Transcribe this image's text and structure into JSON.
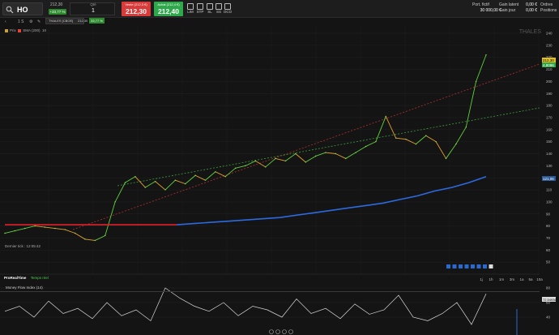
{
  "topbar": {
    "symbol": "HO",
    "last_price": "212,30",
    "change_pct": "+33,77 %",
    "qty_label": "Qté",
    "qty_value": "1",
    "sell_label": "Vente (212,3 €)",
    "sell_price": "212,30",
    "buy_label": "Achat (212,4 €)",
    "buy_price": "212,40",
    "order_types": [
      "LIM",
      "STP",
      "SL",
      "SS",
      "OCO"
    ],
    "portfolio_label": "Port. fictif",
    "portfolio_value": "30 000,00 €",
    "pnl_latent_label": "Gain latent",
    "pnl_latent_value": "0,00 €",
    "pnl_day_label": "Gain jour",
    "pnl_day_value": "0,00 €",
    "orders_label": "Ordres",
    "orders_value": "0",
    "positions_label": "Positions",
    "positions_value": "0"
  },
  "toolbar": {
    "interval": "1 S",
    "instrument_tag": "THALES [CBOE]",
    "instrument_price": "212,30",
    "instrument_pct": "33,77 %"
  },
  "legend": {
    "items": [
      {
        "label": "Prix",
        "color": "#c8a040"
      },
      {
        "label": "SMA (200)",
        "color": "#e0443a"
      },
      {
        "label": "10",
        "color": "#555555"
      }
    ]
  },
  "chart": {
    "watermark": "THALES",
    "last_price_tag": "212,30",
    "sma_tag": "4,8096",
    "sma200_tag": "121,06",
    "timestamp": "Dernier tick : 12:05:42",
    "pp_label": "ProRealTime",
    "pp_sub": "Temps réel",
    "timeframes": [
      "1j",
      "1h",
      "1m",
      "3m",
      "1a",
      "5a",
      "10a"
    ],
    "sub_indicator": "Money Flow Index (14)",
    "sub_value_tag": "72,54936"
  },
  "chart_data": {
    "type": "line",
    "title": "",
    "xlabel": "",
    "ylabel": "",
    "ylim": [
      40,
      240
    ],
    "y_ticks": [
      50,
      60,
      70,
      80,
      90,
      100,
      110,
      120,
      130,
      140,
      150,
      160,
      170,
      180,
      190,
      200,
      210,
      220,
      230,
      240
    ],
    "series": [
      {
        "name": "Prix",
        "values": [
          74,
          76,
          78,
          80,
          79,
          78,
          77,
          74,
          69,
          68,
          72,
          100,
          116,
          121,
          112,
          117,
          110,
          118,
          115,
          122,
          118,
          125,
          121,
          128,
          130,
          134,
          129,
          136,
          134,
          140,
          133,
          138,
          141,
          140,
          136,
          141,
          146,
          150,
          171,
          153,
          152,
          148,
          155,
          150,
          136,
          148,
          162,
          200,
          222
        ]
      },
      {
        "name": "SMA (200)",
        "values": [
          81,
          81,
          81,
          81,
          81,
          81,
          81,
          81,
          81,
          81,
          81,
          82,
          83,
          84,
          85,
          86,
          87,
          89,
          91,
          93,
          95,
          97,
          99,
          102,
          105,
          109,
          112,
          116,
          121
        ]
      }
    ],
    "sub_chart": {
      "name": "Money Flow Index (14)",
      "ylim": [
        20,
        80
      ],
      "y_ticks": [
        40,
        60,
        80
      ],
      "values": [
        48,
        55,
        40,
        62,
        45,
        52,
        38,
        60,
        42,
        50,
        35,
        80,
        66,
        55,
        48,
        60,
        42,
        55,
        50,
        40,
        65,
        45,
        52,
        38,
        58,
        44,
        50,
        70,
        40,
        35,
        45,
        60,
        30,
        72
      ]
    }
  }
}
